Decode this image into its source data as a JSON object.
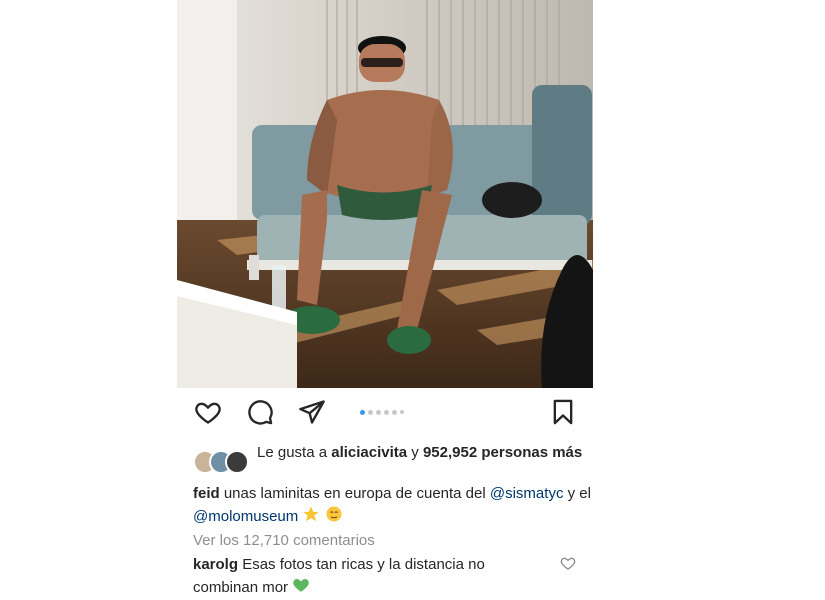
{
  "post": {
    "likes": {
      "prefix": "Le gusta a",
      "user": "aliciacivita",
      "connector": "y",
      "count_text": "952,952 personas más"
    },
    "caption": {
      "username": "feid",
      "text_part1": "unas laminitas en europa de cuenta del",
      "mention1": "@sismatyc",
      "connector": "y el",
      "mention2": "@molomuseum"
    },
    "view_comments": "Ver los 12,710 comentarios",
    "comment": {
      "username": "karolg",
      "text": "Esas fotos tan ricas y la distancia no combinan mor"
    },
    "carousel": {
      "total": 6,
      "active_index": 1
    }
  },
  "icons": {
    "like": "heart-icon",
    "comment": "comment-icon",
    "share": "send-icon",
    "save": "bookmark-icon",
    "comment_like": "heart-outline-icon"
  },
  "colors": {
    "text": "#262626",
    "muted": "#8e8e8e",
    "mention": "#00376b",
    "carousel_active": "#3897f0",
    "heart_emoji": "#5cb85c"
  }
}
